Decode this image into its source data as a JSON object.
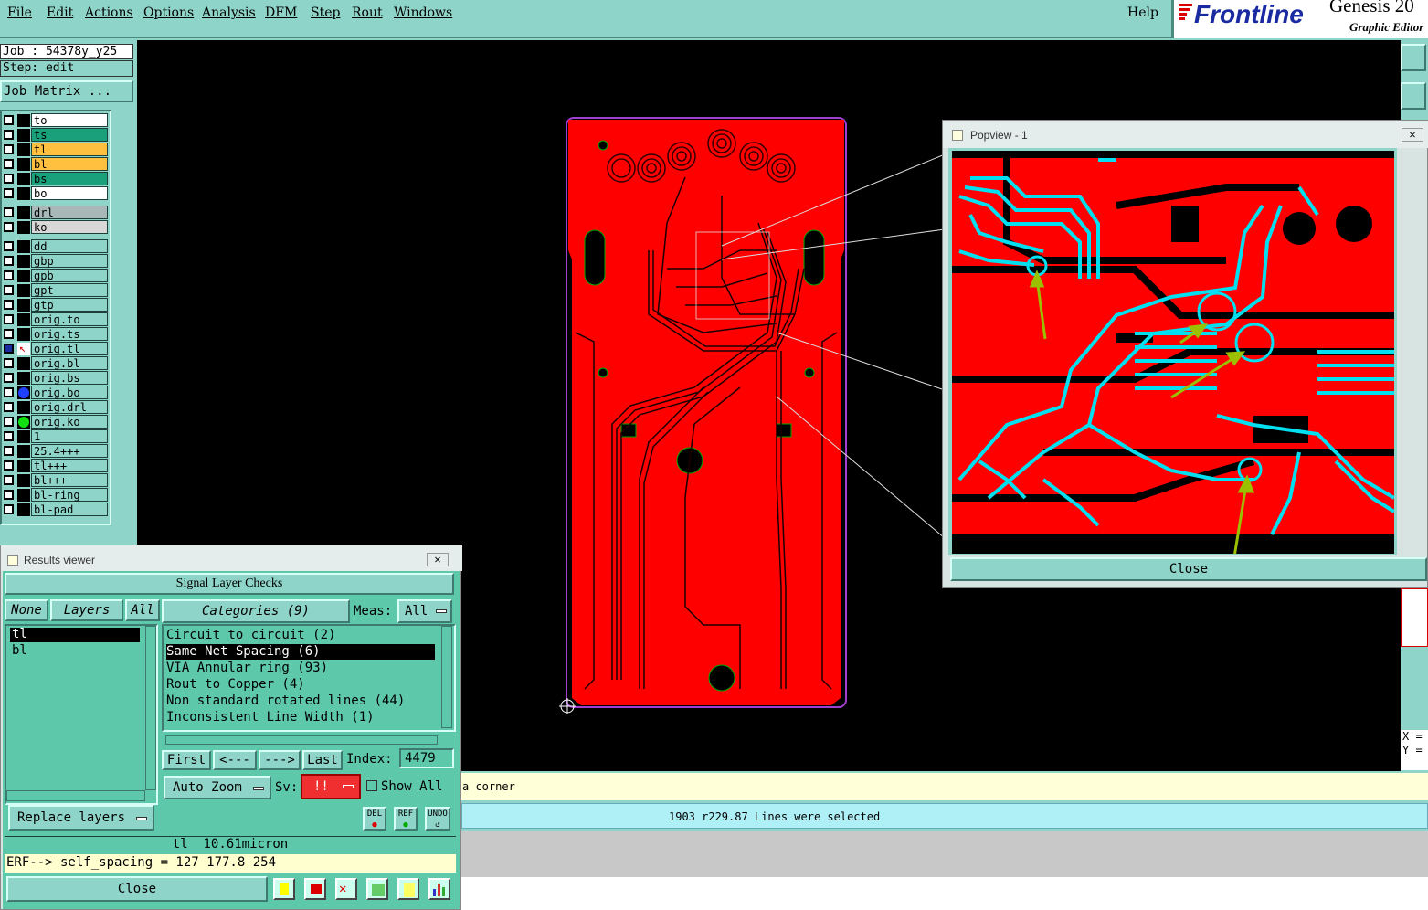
{
  "menu": {
    "items": [
      "File",
      "Edit",
      "Actions",
      "Options",
      "Analysis",
      "DFM",
      "Step",
      "Rout",
      "Windows"
    ],
    "help": "Help"
  },
  "brand": {
    "logo": "Frontline",
    "product": "Genesis 20",
    "subtitle": "Graphic Editor"
  },
  "job": {
    "job_label": "Job : 54378y_y25",
    "step_label": "Step: edit",
    "matrix_button": "Job Matrix ..."
  },
  "layers": {
    "group1": [
      {
        "name": "to",
        "color": "#ffffff"
      },
      {
        "name": "ts",
        "color": "#1aa07a"
      },
      {
        "name": "tl",
        "color": "#ffc040"
      },
      {
        "name": "bl",
        "color": "#ffc040"
      },
      {
        "name": "bs",
        "color": "#1aa07a"
      },
      {
        "name": "bo",
        "color": "#ffffff"
      }
    ],
    "group2": [
      {
        "name": "drl",
        "color": "#a8b8b8"
      },
      {
        "name": "ko",
        "color": "#d8d8d8"
      }
    ],
    "group3": [
      "dd",
      "gbp",
      "gpb",
      "gpt",
      "gtp",
      "orig.to",
      "orig.ts",
      "orig.tl",
      "orig.bl",
      "orig.bs",
      "orig.bo",
      "orig.drl",
      "orig.ko",
      "1",
      "25.4+++",
      "tl+++",
      "bl+++",
      "bl-ring",
      "bl-pad"
    ]
  },
  "popview": {
    "title": "Popview - 1",
    "close_label": "Close"
  },
  "results": {
    "title": "Results viewer",
    "header": "Signal Layer Checks",
    "none_label": "None",
    "layers_label": "Layers",
    "all_label": "All",
    "categories_label": "Categories (9)",
    "meas_label": "Meas:",
    "meas_value": "All",
    "layer_list": [
      "tl",
      "bl"
    ],
    "categories": [
      "Circuit to circuit (2)",
      "Same Net Spacing (6)",
      "VIA Annular ring (93)",
      "Rout to Copper (4)",
      "Non standard rotated lines (44)",
      "Inconsistent Line Width (1)"
    ],
    "first_label": "First",
    "prev_label": "<---",
    "next_label": "--->",
    "last_label": "Last",
    "index_label": "Index:",
    "index_value": "4479",
    "auto_zoom_label": "Auto Zoom",
    "sv_label": "Sv:",
    "sv_value": "!!",
    "show_all_label": "Show All",
    "replace_layers_label": "Replace layers",
    "del_label": "DEL",
    "ref_label": "REF",
    "undo_label": "UNDO",
    "status_line": "tl  10.61micron",
    "erf_line": "ERF--> self_spacing = 127 177.8 254",
    "close_label": "Close"
  },
  "status": {
    "message": "a corner",
    "selection": "1903 r229.87 Lines were selected",
    "coords": "X =\nY ="
  }
}
